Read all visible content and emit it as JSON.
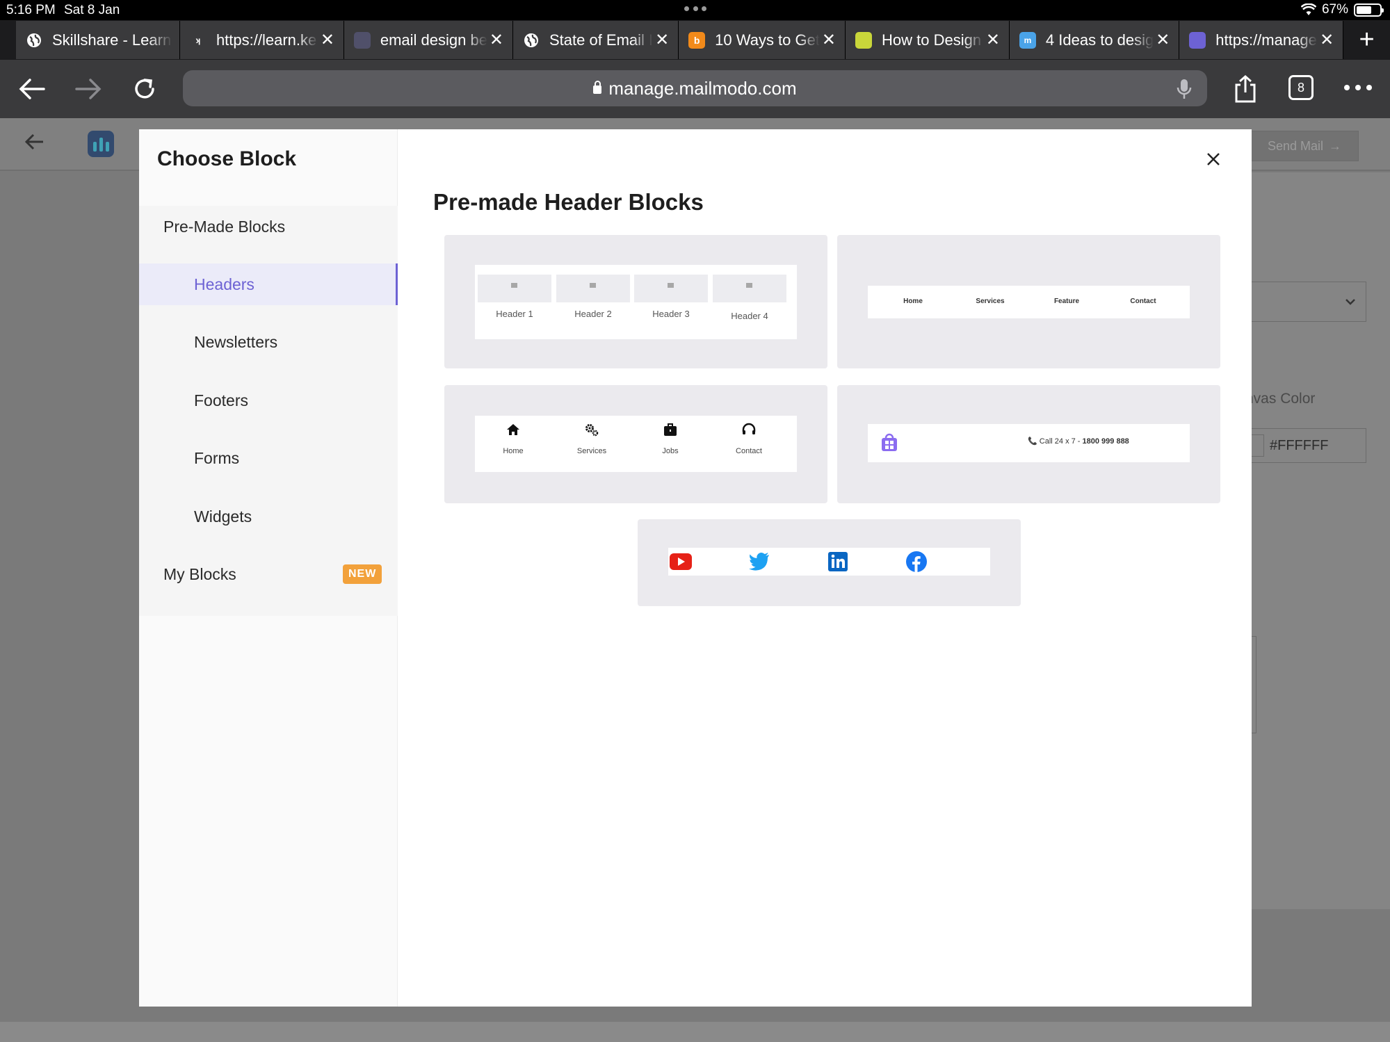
{
  "status": {
    "time": "5:16 PM",
    "date": "Sat 8 Jan",
    "battery": "67%",
    "battery_level": 0.67
  },
  "tabs": [
    {
      "title": "Skillshare - Learn",
      "icon": "globe-icon"
    },
    {
      "title": "https://learn.ke",
      "icon": "site-icon"
    },
    {
      "title": "email design be",
      "icon": "calendar-icon"
    },
    {
      "title": "State of Email I",
      "icon": "globe-icon"
    },
    {
      "title": "10 Ways to Get",
      "icon": "b-logo-icon"
    },
    {
      "title": "How to Design",
      "icon": "mascot-icon"
    },
    {
      "title": "4 Ideas to desig",
      "icon": "chat-icon"
    },
    {
      "title": "https://manage",
      "icon": "mailmodo-icon",
      "active": true
    }
  ],
  "browser": {
    "url": "manage.mailmodo.com",
    "tab_count": "8"
  },
  "page": {
    "send_mail": "Send Mail",
    "canvas_color_label": "nvas Color",
    "canvas_color_value": "#FFFFFF"
  },
  "modal": {
    "title": "Choose Block",
    "heading": "Pre-made Header Blocks",
    "sections": {
      "premade": "Pre-Made Blocks",
      "headers": "Headers",
      "newsletters": "Newsletters",
      "footers": "Footers",
      "forms": "Forms",
      "widgets": "Widgets",
      "myblocks": "My Blocks",
      "new_badge": "NEW"
    },
    "block1": {
      "labels": [
        "Header 1",
        "Header 2",
        "Header 3",
        "Header 4"
      ]
    },
    "block2": {
      "links": [
        "Home",
        "Services",
        "Feature",
        "Contact"
      ]
    },
    "block3": {
      "items": [
        {
          "label": "Home",
          "icon": "home-icon"
        },
        {
          "label": "Services",
          "icon": "gears-icon"
        },
        {
          "label": "Jobs",
          "icon": "briefcase-icon"
        },
        {
          "label": "Contact",
          "icon": "headset-icon"
        }
      ]
    },
    "block4": {
      "call_text": "Call 24 x 7 - ",
      "phone": "1800 999 888"
    },
    "block5": {
      "icons": [
        "youtube-icon",
        "twitter-icon",
        "linkedin-icon",
        "facebook-icon"
      ]
    }
  },
  "colors": {
    "accent": "#6d62d4",
    "badge": "#f2a13b",
    "card_bg": "#ebeaee",
    "youtube": "#e62117",
    "twitter": "#1da1f2",
    "linkedin": "#0a66c2",
    "facebook": "#1877f2"
  }
}
